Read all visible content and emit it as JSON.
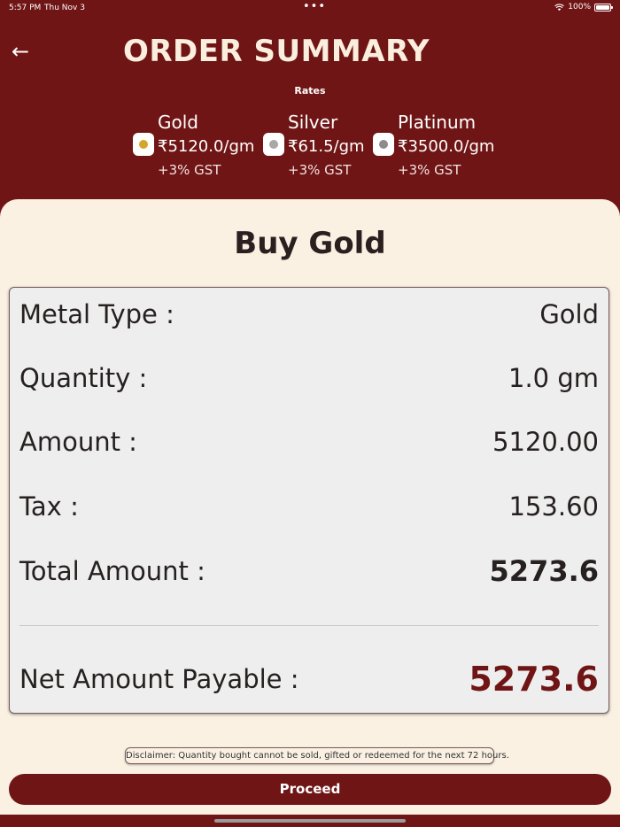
{
  "status_bar": {
    "time": "5:57 PM",
    "date": "Thu Nov 3",
    "dots": "•••",
    "battery": "100%"
  },
  "header": {
    "back_icon": "←",
    "title": "ORDER SUMMARY",
    "rates_label": "Rates"
  },
  "rates": [
    {
      "name": "Gold",
      "price": "₹5120.0/gm",
      "gst": "+3% GST",
      "icon": "gold-coin-icon",
      "color": "#d4a62a"
    },
    {
      "name": "Silver",
      "price": "₹61.5/gm",
      "gst": "+3% GST",
      "icon": "silver-coin-icon",
      "color": "#a8a8a8"
    },
    {
      "name": "Platinum",
      "price": "₹3500.0/gm",
      "gst": "+3% GST",
      "icon": "platinum-coin-icon",
      "color": "#8c8c8c"
    }
  ],
  "section_title": "Buy Gold",
  "summary": {
    "metal_type_label": "Metal Type :",
    "metal_type_value": "Gold",
    "quantity_label": "Quantity :",
    "quantity_value": "1.0 gm",
    "amount_label": "Amount :",
    "amount_value": "5120.00",
    "tax_label": "Tax :",
    "tax_value": "153.60",
    "total_label": "Total Amount :",
    "total_value": "5273.6",
    "net_label": "Net Amount Payable :",
    "net_value": "5273.6"
  },
  "disclaimer": "Disclaimer: Quantity bought cannot be sold, gifted or redeemed for the next 72 hours.",
  "proceed_label": "Proceed",
  "colors": {
    "primary": "#701515",
    "panel": "#faf1e3",
    "card": "#eeeeee"
  }
}
